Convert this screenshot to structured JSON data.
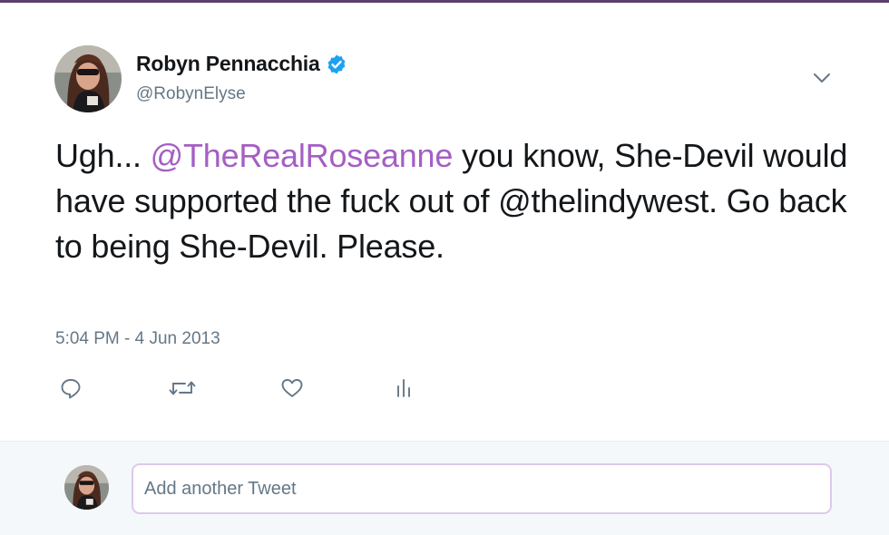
{
  "author": {
    "name": "Robyn Pennacchia",
    "handle": "@RobynElyse",
    "verified": true
  },
  "tweet": {
    "text_before": "Ugh... ",
    "mention": "@TheRealRoseanne",
    "text_after": " you know, She-Devil would have supported the fuck out of @thelindywest. Go back to being She-Devil. Please.",
    "timestamp": "5:04 PM - 4 Jun 2013"
  },
  "actions": [
    {
      "icon": "reply-icon"
    },
    {
      "icon": "retweet-icon"
    },
    {
      "icon": "like-icon"
    },
    {
      "icon": "analytics-icon"
    }
  ],
  "composer": {
    "placeholder": "Add another Tweet"
  },
  "colors": {
    "accent": "#a45fc3",
    "verified_badge": "#1da1f2",
    "secondary_text": "#657786",
    "input_border": "#dcc9ea"
  }
}
